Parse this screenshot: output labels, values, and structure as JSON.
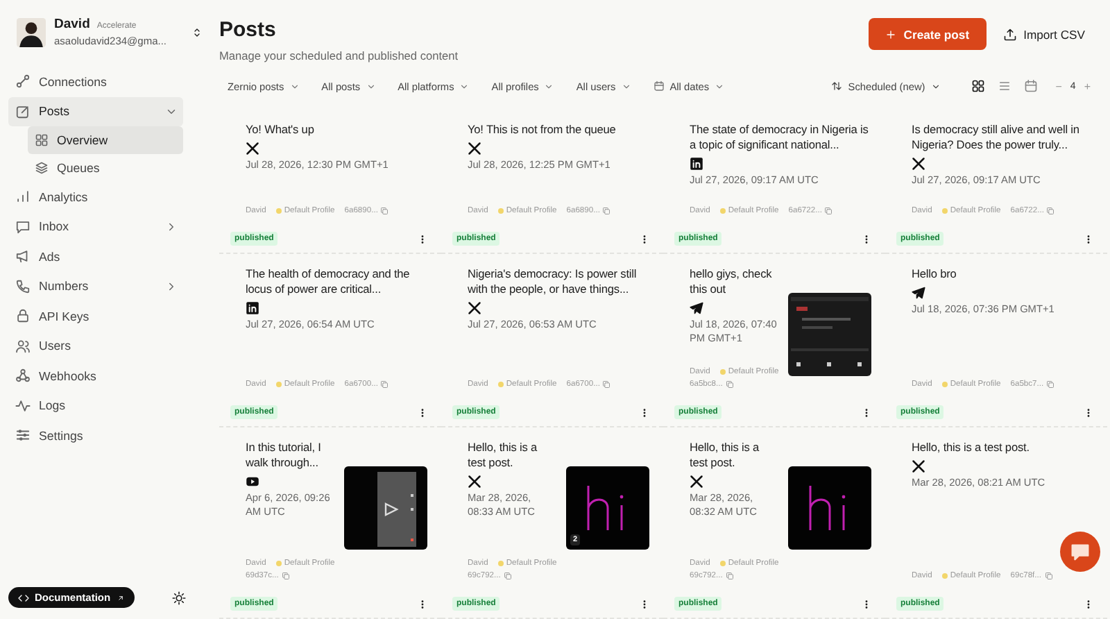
{
  "account": {
    "name": "David",
    "plan": "Accelerate",
    "email": "asaoludavid234@gma..."
  },
  "sidebar": {
    "items": [
      {
        "label": "Connections",
        "selected": false
      },
      {
        "label": "Posts",
        "selected": true,
        "expanded": true,
        "children": [
          {
            "label": "Overview",
            "selected": true
          },
          {
            "label": "Queues",
            "selected": false
          }
        ]
      },
      {
        "label": "Analytics",
        "selected": false
      },
      {
        "label": "Inbox",
        "selected": false,
        "expanded": false
      },
      {
        "label": "Ads",
        "selected": false
      },
      {
        "label": "Numbers",
        "selected": false,
        "expanded": false
      },
      {
        "label": "API Keys",
        "selected": false
      },
      {
        "label": "Users",
        "selected": false
      },
      {
        "label": "Webhooks",
        "selected": false
      },
      {
        "label": "Logs",
        "selected": false
      },
      {
        "label": "Settings",
        "selected": false
      }
    ],
    "documentation_button": "Documentation"
  },
  "header": {
    "title": "Posts",
    "subtitle": "Manage your scheduled and published content",
    "create_button": "Create post",
    "import_button": "Import CSV"
  },
  "filters": [
    {
      "label": "Zernio posts"
    },
    {
      "label": "All posts"
    },
    {
      "label": "All platforms"
    },
    {
      "label": "All profiles"
    },
    {
      "label": "All users"
    },
    {
      "label": "All dates",
      "kind": "date"
    }
  ],
  "sort": "Scheduled (new)",
  "views": [
    {
      "selected": true
    },
    {
      "selected": false
    },
    {
      "selected": false
    }
  ],
  "columns": {
    "minus": "−",
    "value": "4",
    "plus": "+"
  },
  "posts": [
    {
      "text": "Yo! What's up",
      "platform": {
        "kind": "x"
      },
      "date": "Jul 28, 2026, 12:30 PM GMT+1",
      "user": "David",
      "profile": "Default Profile",
      "id": "6a6890...",
      "status": "published"
    },
    {
      "text": "Yo! This is not from the queue",
      "platform": {
        "kind": "x"
      },
      "date": "Jul 28, 2026, 12:25 PM GMT+1",
      "user": "David",
      "profile": "Default Profile",
      "id": "6a6890...",
      "status": "published"
    },
    {
      "text": "The state of democracy in Nigeria is a topic of significant national...",
      "platform": {
        "kind": "linkedin"
      },
      "date": "Jul 27, 2026, 09:17 AM UTC",
      "user": "David",
      "profile": "Default Profile",
      "id": "6a6722...",
      "status": "published"
    },
    {
      "text": "Is democracy still alive and well in Nigeria? Does the power truly...",
      "platform": {
        "kind": "x"
      },
      "date": "Jul 27, 2026, 09:17 AM UTC",
      "user": "David",
      "profile": "Default Profile",
      "id": "6a6722...",
      "status": "published"
    },
    {
      "text": "The health of democracy and the locus of power are critical...",
      "platform": {
        "kind": "linkedin"
      },
      "date": "Jul 27, 2026, 06:54 AM UTC",
      "user": "David",
      "profile": "Default Profile",
      "id": "6a6700...",
      "status": "published"
    },
    {
      "text": "Nigeria's democracy: Is power still with the people, or have things...",
      "platform": {
        "kind": "x"
      },
      "date": "Jul 27, 2026, 06:53 AM UTC",
      "user": "David",
      "profile": "Default Profile",
      "id": "6a6700...",
      "status": "published"
    },
    {
      "text": "hello giys, check this out",
      "platform": {
        "kind": "telegram"
      },
      "date": "Jul 18, 2026, 07:40 PM GMT+1",
      "user": "David",
      "profile": "Default Profile",
      "id": "6a5bc8...",
      "status": "published"
    },
    {
      "text": "Hello bro",
      "platform": {
        "kind": "telegram"
      },
      "date": "Jul 18, 2026, 07:36 PM GMT+1",
      "user": "David",
      "profile": "Default Profile",
      "id": "6a5bc7...",
      "status": "published"
    },
    {
      "text": "In this tutorial, I walk through...",
      "platform": {
        "kind": "youtube"
      },
      "date": "Apr 6, 2026, 09:26 AM UTC",
      "user": "David",
      "profile": "Default Profile",
      "id": "69d37c...",
      "status": "published"
    },
    {
      "text": "Hello, this is a test post.",
      "platform": {
        "kind": "x"
      },
      "date": "Mar 28, 2026, 08:33 AM UTC",
      "user": "David",
      "profile": "Default Profile",
      "id": "69c792...",
      "status": "published",
      "media": {
        "kind": "picture",
        "count": "2"
      }
    },
    {
      "text": "Hello, this is a test post.",
      "platform": {
        "kind": "x"
      },
      "date": "Mar 28, 2026, 08:32 AM UTC",
      "user": "David",
      "profile": "Default Profile",
      "id": "69c792...",
      "status": "published"
    },
    {
      "text": "Hello, this is a test post.",
      "platform": {
        "kind": "x"
      },
      "date": "Mar 28, 2026, 08:21 AM UTC",
      "user": "David",
      "profile": "Default Profile",
      "id": "69c78f...",
      "status": "published"
    }
  ]
}
